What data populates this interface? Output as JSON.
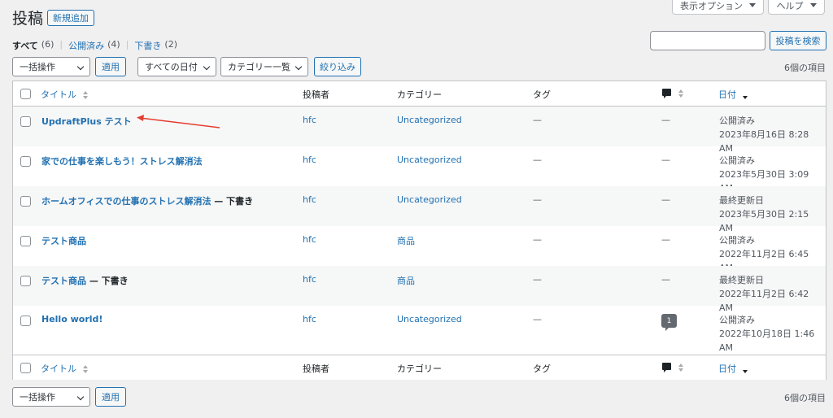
{
  "header": {
    "title": "投稿",
    "add_new": "新規追加",
    "screen_options": "表示オプション",
    "help": "ヘルプ"
  },
  "views": {
    "all": {
      "label": "すべて",
      "count": "(6)"
    },
    "publish": {
      "label": "公開済み",
      "count": "(4)"
    },
    "draft": {
      "label": "下書き",
      "count": "(2)"
    },
    "sep": "|"
  },
  "search": {
    "button": "投稿を検索",
    "value": ""
  },
  "tablenav_top": {
    "bulk_action": "一括操作",
    "apply": "適用",
    "date_filter": "すべての日付",
    "category_filter": "カテゴリー一覧",
    "filter_button": "絞り込み",
    "items": "6個の項目"
  },
  "tablenav_bottom": {
    "bulk_action": "一括操作",
    "apply": "適用",
    "items": "6個の項目"
  },
  "columns": {
    "title": "タイトル",
    "author": "投稿者",
    "categories": "カテゴリー",
    "tags": "タグ",
    "date": "日付"
  },
  "posts": [
    {
      "title": "UpdraftPlus テスト",
      "state": "",
      "author": "hfc",
      "category": "Uncategorized",
      "tags": "—",
      "comments": "—",
      "status": "公開済み",
      "date": "2023年8月16日 8:28 AM"
    },
    {
      "title": "家での仕事を楽しもう！ストレス解消法",
      "state": "",
      "author": "hfc",
      "category": "Uncategorized",
      "tags": "—",
      "comments": "—",
      "status": "公開済み",
      "date": "2023年5月30日 3:09 AM"
    },
    {
      "title": "ホームオフィスでの仕事のストレス解消法",
      "state": " — 下書き",
      "author": "hfc",
      "category": "Uncategorized",
      "tags": "—",
      "comments": "—",
      "status": "最終更新日",
      "date": "2023年5月30日 2:15 AM"
    },
    {
      "title": "テスト商品",
      "state": "",
      "author": "hfc",
      "category": "商品",
      "tags": "—",
      "comments": "—",
      "status": "公開済み",
      "date": "2022年11月2日 6:45 AM"
    },
    {
      "title": "テスト商品",
      "state": " — 下書き",
      "author": "hfc",
      "category": "商品",
      "tags": "—",
      "comments": "—",
      "status": "最終更新日",
      "date": "2022年11月2日 6:42 AM"
    },
    {
      "title": "Hello world!",
      "state": "",
      "author": "hfc",
      "category": "Uncategorized",
      "tags": "—",
      "comments": "1",
      "status": "公開済み",
      "date": "2022年10月18日 1:46 AM"
    }
  ],
  "colors": {
    "link": "#2271b1",
    "annotation_arrow": "#e53e2f"
  }
}
